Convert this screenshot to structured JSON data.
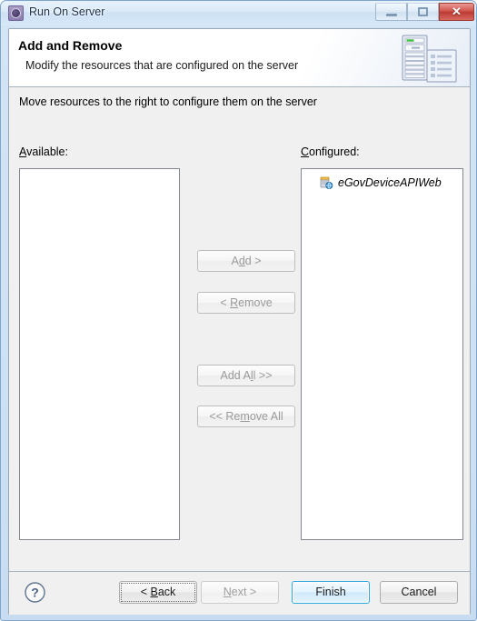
{
  "window": {
    "title": "Run On Server",
    "icon": "run-on-server-icon",
    "controls": {
      "minimize": "minimize-icon",
      "maximize": "maximize-icon",
      "close_label": "✕"
    }
  },
  "banner": {
    "title": "Add and Remove",
    "subtitle": "Modify the resources that are configured on the server",
    "icon": "server-and-document-icon"
  },
  "main": {
    "instruction": "Move resources to the right to configure them on the server",
    "available": {
      "label_prefix": "",
      "label_mnemonic": "A",
      "label_suffix": "vailable:",
      "items": []
    },
    "configured": {
      "label_prefix": "",
      "label_mnemonic": "C",
      "label_suffix": "onfigured:",
      "items": [
        {
          "name": "eGovDeviceAPIWeb",
          "icon": "web-module-icon"
        }
      ]
    },
    "transfer_buttons": [
      {
        "id": "add",
        "before": "A",
        "mnemonic": "d",
        "after": "d >",
        "enabled": false
      },
      {
        "id": "remove",
        "before": "< ",
        "mnemonic": "R",
        "after": "emove",
        "enabled": false
      },
      {
        "id": "add-all",
        "before": "Add A",
        "mnemonic": "l",
        "after": "l >>",
        "enabled": false
      },
      {
        "id": "remove-all",
        "before": "<< Re",
        "mnemonic": "m",
        "after": "ove All",
        "enabled": false
      }
    ]
  },
  "footer": {
    "help": "help-icon",
    "back": {
      "before": "< ",
      "mnemonic": "B",
      "after": "ack",
      "enabled": true,
      "focused": true
    },
    "next": {
      "before": "",
      "mnemonic": "N",
      "after": "ext >",
      "enabled": false,
      "focused": false
    },
    "finish": {
      "label": "Finish",
      "enabled": true,
      "default": true
    },
    "cancel": {
      "label": "Cancel",
      "enabled": true,
      "default": false
    }
  },
  "colors": {
    "titlebar": "#dbeaf8",
    "frame": "#cfe1f4",
    "dialog_bg": "#f0f0f0",
    "banner_bg": "#ffffff",
    "default_button_border": "#2ea9e0",
    "close_button": "#bb3a32",
    "listbox_border": "#828790"
  }
}
